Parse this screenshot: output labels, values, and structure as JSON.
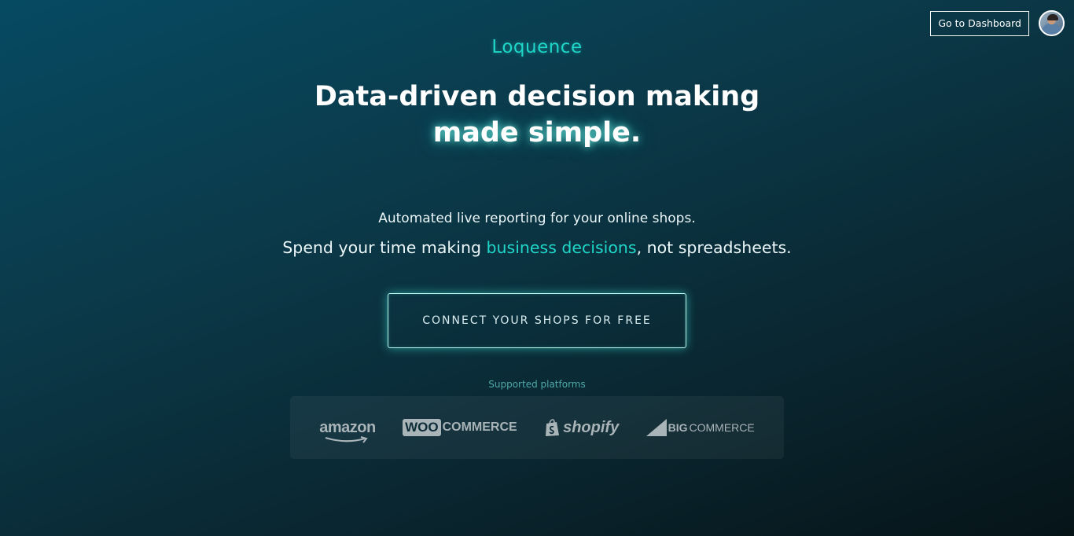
{
  "header": {
    "dashboard_button": "Go to Dashboard"
  },
  "hero": {
    "brand": "Loquence",
    "headline_line1": "Data-driven decision making",
    "headline_line2": "made simple.",
    "sub1": "Automated live reporting for your online shops.",
    "sub2_prefix": "Spend your time making ",
    "sub2_highlight": "business decisions",
    "sub2_suffix": ", not spreadsheets.",
    "cta_label": "CONNECT YOUR SHOPS FOR FREE"
  },
  "platforms": {
    "label": "Supported platforms",
    "amazon": "amazon",
    "woo_box": "WOO",
    "woo_text": "COMMERCE",
    "shopify": "shopify",
    "big_prefix": "BIG",
    "big_text": "COMMERCE"
  },
  "colors": {
    "accent": "#1fd6c8",
    "text": "#ffffff",
    "muted_logo": "#a9b4b8"
  }
}
